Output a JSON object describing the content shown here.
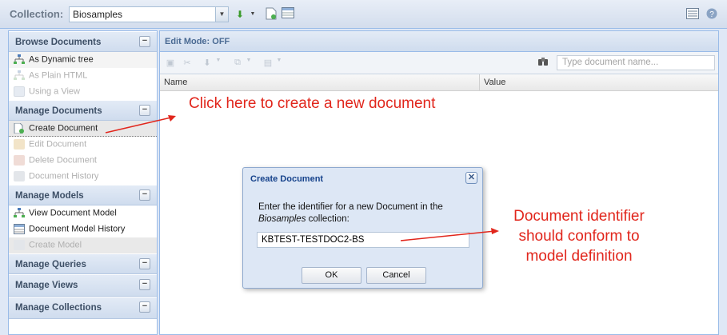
{
  "topbar": {
    "collection_label": "Collection:",
    "collection_value": "Biosamples"
  },
  "sidebar": {
    "sections": [
      {
        "title": "Browse Documents",
        "items": [
          "As Dynamic tree",
          "As Plain HTML",
          "Using a View"
        ]
      },
      {
        "title": "Manage Documents",
        "items": [
          "Create Document",
          "Edit Document",
          "Delete Document",
          "Document History"
        ]
      },
      {
        "title": "Manage Models",
        "items": [
          "View Document Model",
          "Document Model History",
          "Create Model"
        ]
      },
      {
        "title": "Manage Queries"
      },
      {
        "title": "Manage Views"
      },
      {
        "title": "Manage Collections"
      }
    ]
  },
  "main": {
    "edit_mode": "Edit Mode: OFF",
    "search_placeholder": "Type document name...",
    "columns": [
      "Name",
      "Value"
    ]
  },
  "dialog": {
    "title": "Create Document",
    "message_line1": "Enter the identifier for a new Document in the",
    "message_collection": "Biosamples",
    "message_line2_rest": " collection:",
    "input_value": "KBTEST-TESTDOC2-BS",
    "ok_label": "OK",
    "cancel_label": "Cancel"
  },
  "annotations": {
    "create_note": "Click here to create a new document",
    "identifier_note": [
      "Document identifier",
      "should conform to",
      "model definition"
    ]
  },
  "colors": {
    "annotation_red": "#e1261c",
    "panel_border": "#99bbe8",
    "dialog_bg": "#dde7f5"
  }
}
